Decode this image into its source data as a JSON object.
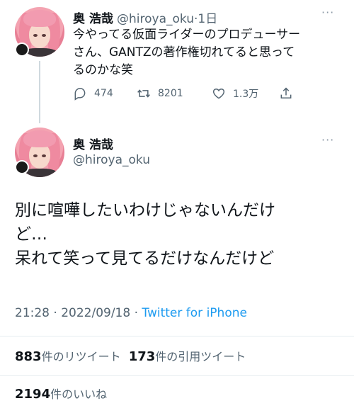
{
  "reply_tweet": {
    "display_name": "奥 浩哉",
    "handle": "@hiroya_oku",
    "time": "·1日",
    "text_lines": [
      "今やってる仮面ライダーのプロデューサー",
      "さん、GANTZの著作権切れてると思って",
      "るのかな笑"
    ],
    "actions": {
      "replies": "474",
      "retweets": "8201",
      "likes": "1.3万"
    },
    "more_label": "···"
  },
  "main_tweet": {
    "display_name": "奥 浩哉",
    "handle": "@hiroya_oku",
    "more_label": "···",
    "text_lines": [
      "別に喧嘩したいわけじゃないんだけ",
      "ど…",
      "呆れて笑って見てるだけなんだけど"
    ],
    "timestamp": "21:28 · 2022/09/18 · ",
    "source": "Twitter for iPhone",
    "stats": {
      "retweet_count": "883",
      "retweet_label": "件のリツイート",
      "quote_count": "173",
      "quote_label": "件の引用ツイート",
      "like_count": "2194",
      "like_label": "件のいいね"
    }
  },
  "icons": [
    "reply-icon",
    "retweet-icon",
    "like-icon",
    "share-icon",
    "more-icon"
  ],
  "colors": {
    "link": "#1d9bf0",
    "muted": "#536471",
    "text": "#0f1419"
  }
}
